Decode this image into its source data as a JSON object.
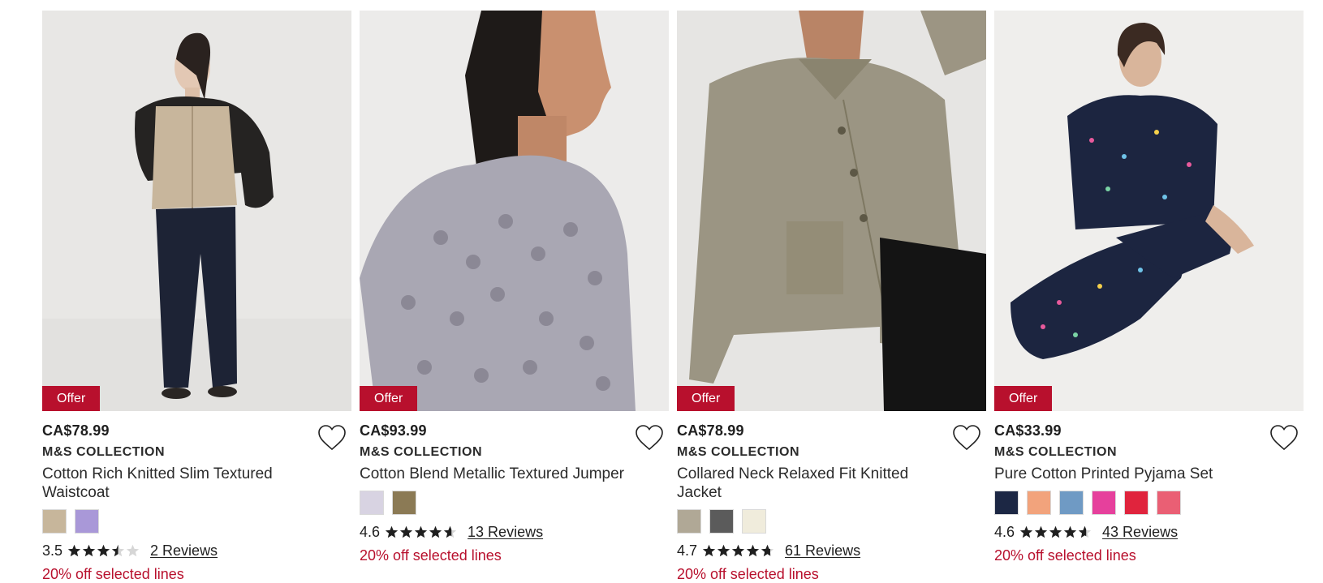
{
  "accent_color": "#b8102d",
  "products": [
    {
      "price": "CA$78.99",
      "brand": "M&S COLLECTION",
      "title": "Cotton Rich Knitted Slim Textured Waistcoat",
      "badge": "Offer",
      "image_desc": "Model wearing beige cable-knit waistcoat over black top with dark jeans",
      "swatches": [
        {
          "name": "beige",
          "color": "#c7b69b"
        },
        {
          "name": "lilac",
          "color": "#a998d8"
        }
      ],
      "rating": "3.5",
      "rating_value": 3.5,
      "reviews": "2 Reviews",
      "promo": "20% off selected lines"
    },
    {
      "price": "CA$93.99",
      "brand": "M&S COLLECTION",
      "title": "Cotton Blend Metallic Textured Jumper",
      "badge": "Offer",
      "image_desc": "Model in silver-grey open-knit metallic jumper",
      "swatches": [
        {
          "name": "silver",
          "color": "#d8d3e2"
        },
        {
          "name": "gold-black",
          "color": "#8b7a55"
        }
      ],
      "rating": "4.6",
      "rating_value": 4.6,
      "reviews": "13 Reviews",
      "promo": "20% off selected lines"
    },
    {
      "price": "CA$78.99",
      "brand": "M&S COLLECTION",
      "title": "Collared Neck Relaxed Fit Knitted Jacket",
      "badge": "Offer",
      "image_desc": "Model in khaki collared knitted jacket with black trousers",
      "swatches": [
        {
          "name": "khaki",
          "color": "#b0a896"
        },
        {
          "name": "charcoal",
          "color": "#5b5b5b"
        },
        {
          "name": "cream",
          "color": "#f0ecdc"
        }
      ],
      "rating": "4.7",
      "rating_value": 4.7,
      "reviews": "61 Reviews",
      "promo": "20% off selected lines"
    },
    {
      "price": "CA$33.99",
      "brand": "M&S COLLECTION",
      "title": "Pure Cotton Printed Pyjama Set",
      "badge": "Offer",
      "image_desc": "Model seated in navy printed pyjama set",
      "swatches": [
        {
          "name": "navy",
          "color": "#1c2744"
        },
        {
          "name": "orange-blue",
          "color": "#f2a37c"
        },
        {
          "name": "blue",
          "color": "#6f9ac4"
        },
        {
          "name": "pink-black",
          "color": "#e6409c"
        },
        {
          "name": "red",
          "color": "#e0243d"
        },
        {
          "name": "pink-red",
          "color": "#ea5f74"
        }
      ],
      "rating": "4.6",
      "rating_value": 4.6,
      "reviews": "43 Reviews",
      "promo": "20% off selected lines"
    }
  ]
}
